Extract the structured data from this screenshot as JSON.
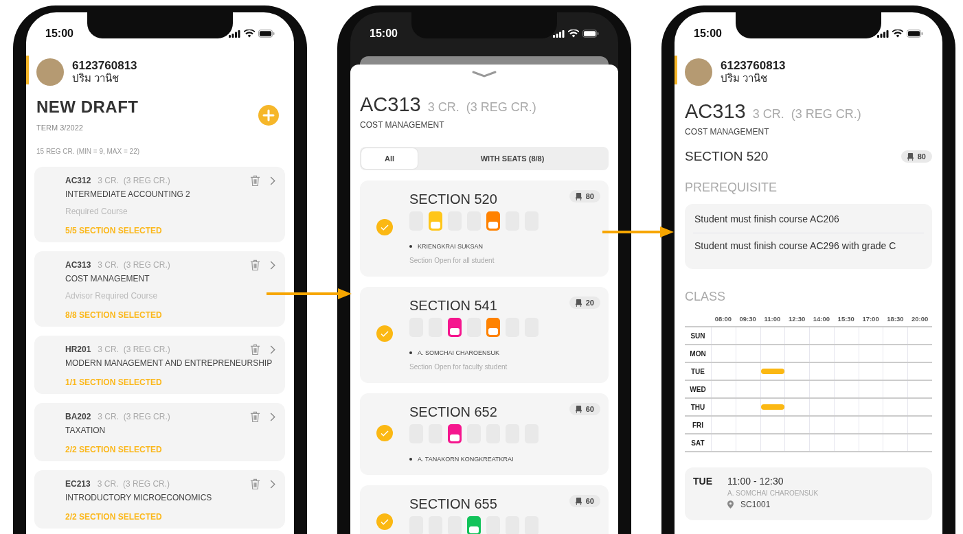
{
  "draft_screen": {
    "time": "15:00",
    "student": {
      "id": "6123760813",
      "name": "ปริม วานิช"
    },
    "title": "NEW DRAFT",
    "term": "TERM 3/2022",
    "credit_summary": "15 REG CR. (MIN = 9, MAX = 22)",
    "courses": [
      {
        "code": "AC312",
        "credits": "3 CR.  (3 REG CR.)",
        "name": "INTERMEDIATE ACCOUNTING 2",
        "note": "Required Course",
        "status": "5/5 SECTION SELECTED"
      },
      {
        "code": "AC313",
        "credits": "3 CR.  (3 REG CR.)",
        "name": "COST MANAGEMENT",
        "note": "Advisor Required Course",
        "status": "8/8 SECTION SELECTED"
      },
      {
        "code": "HR201",
        "credits": "3 CR.  (3 REG CR.)",
        "name": "MODERN MANAGEMENT AND ENTREPRENEURSHIP",
        "status": "1/1 SECTION SELECTED"
      },
      {
        "code": "BA202",
        "credits": "3 CR.  (3 REG CR.)",
        "name": "TAXATION",
        "status": "2/2 SECTION SELECTED"
      },
      {
        "code": "EC213",
        "credits": "3 CR.  (3 REG CR.)",
        "name": "INTRODUCTORY MICROECONOMICS",
        "status": "2/2 SECTION SELECTED"
      }
    ]
  },
  "sections_screen": {
    "time": "15:00",
    "course": {
      "code": "AC313",
      "credits": "3 CR.  (3 REG CR.)",
      "name": "COST MANAGEMENT"
    },
    "filters": [
      {
        "label": "All",
        "selected": true
      },
      {
        "label": "WITH SEATS (8/8)",
        "selected": false
      }
    ],
    "sections": [
      {
        "name": "SECTION 520",
        "seats": "80",
        "checked": true,
        "slots": [
          {
            "filled": false
          },
          {
            "filled": true,
            "color": "#ffc61a"
          },
          {
            "filled": false
          },
          {
            "filled": false
          },
          {
            "filled": true,
            "color": "#ff8200"
          },
          {
            "filled": false
          },
          {
            "filled": false
          }
        ],
        "instructor": "KRIENGKRAI SUKSAN",
        "note": "Section Open for all student"
      },
      {
        "name": "SECTION 541",
        "seats": "20",
        "checked": true,
        "slots": [
          {
            "filled": false
          },
          {
            "filled": false
          },
          {
            "filled": true,
            "color": "#f5168e"
          },
          {
            "filled": false
          },
          {
            "filled": true,
            "color": "#ff8200"
          },
          {
            "filled": false
          },
          {
            "filled": false
          }
        ],
        "instructor": "A. SOMCHAI CHAROENSUK",
        "note": "Section Open for faculty student"
      },
      {
        "name": "SECTION 652",
        "seats": "60",
        "checked": true,
        "slots": [
          {
            "filled": false
          },
          {
            "filled": false
          },
          {
            "filled": true,
            "color": "#f5168e"
          },
          {
            "filled": false
          },
          {
            "filled": false
          },
          {
            "filled": false
          },
          {
            "filled": false
          }
        ],
        "instructor": "A. TANAKORN KONGKREATKRAI"
      },
      {
        "name": "SECTION 655",
        "seats": "60",
        "checked": true,
        "slots": [
          {
            "filled": false
          },
          {
            "filled": false
          },
          {
            "filled": false
          },
          {
            "filled": true,
            "color": "#12c35a"
          },
          {
            "filled": false
          },
          {
            "filled": false
          },
          {
            "filled": false
          }
        ]
      }
    ]
  },
  "detail_screen": {
    "time": "15:00",
    "student": {
      "id": "6123760813",
      "name": "ปริม วานิช"
    },
    "course": {
      "code": "AC313",
      "credits": "3 CR.  (3 REG CR.)",
      "name": "COST MANAGEMENT"
    },
    "section": {
      "name": "SECTION 520",
      "seats": "80"
    },
    "prerequisite_heading": "PREREQUISITE",
    "prerequisites": [
      "Student must finish course AC206",
      "Student must finish course AC296 with grade C"
    ],
    "class_heading": "CLASS",
    "timetable": {
      "times": [
        "08:00",
        "09:30",
        "11:00",
        "12:30",
        "14:00",
        "15:30",
        "17:00",
        "18:30",
        "20:00"
      ],
      "days": [
        {
          "label": "SUN",
          "slots": [
            false,
            false,
            false,
            false,
            false,
            false,
            false,
            false,
            false
          ]
        },
        {
          "label": "MON",
          "slots": [
            false,
            false,
            false,
            false,
            false,
            false,
            false,
            false,
            false
          ]
        },
        {
          "label": "TUE",
          "slots": [
            false,
            false,
            true,
            false,
            false,
            false,
            false,
            false,
            false
          ]
        },
        {
          "label": "WED",
          "slots": [
            false,
            false,
            false,
            false,
            false,
            false,
            false,
            false,
            false
          ]
        },
        {
          "label": "THU",
          "slots": [
            false,
            false,
            true,
            false,
            false,
            false,
            false,
            false,
            false
          ]
        },
        {
          "label": "FRI",
          "slots": [
            false,
            false,
            false,
            false,
            false,
            false,
            false,
            false,
            false
          ]
        },
        {
          "label": "SAT",
          "slots": [
            false,
            false,
            false,
            false,
            false,
            false,
            false,
            false,
            false
          ]
        }
      ]
    },
    "meetings": [
      {
        "day": "TUE",
        "time": "11:00 - 12:30",
        "instructor": "A. SOMCHAI CHAROENSUK",
        "room": "SC1001"
      }
    ]
  }
}
